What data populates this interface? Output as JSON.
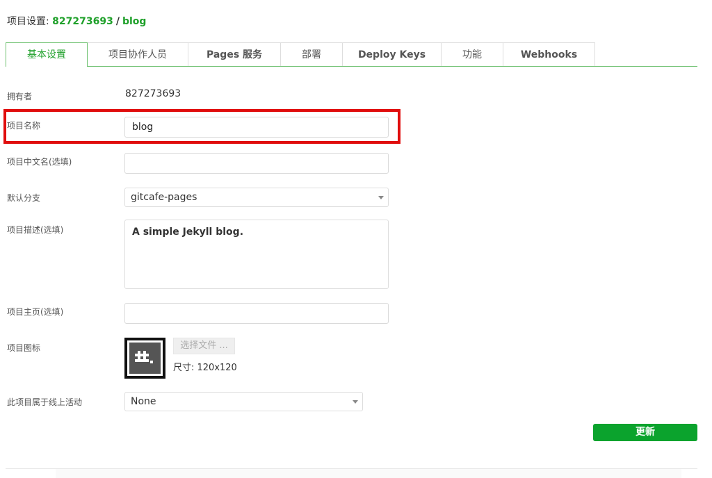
{
  "header": {
    "prefix": "项目设置:",
    "owner": "827273693",
    "separator": "/",
    "project": "blog"
  },
  "tabs": [
    {
      "label": "基本设置",
      "active": true
    },
    {
      "label": "项目协作人员",
      "active": false
    },
    {
      "label": "Pages 服务",
      "active": false
    },
    {
      "label": "部署",
      "active": false
    },
    {
      "label": "Deploy Keys",
      "active": false
    },
    {
      "label": "功能",
      "active": false
    },
    {
      "label": "Webhooks",
      "active": false
    }
  ],
  "form": {
    "owner": {
      "label": "拥有者",
      "value": "827273693"
    },
    "name": {
      "label": "项目名称",
      "value": "blog"
    },
    "cn_name": {
      "label": "项目中文名(选填)",
      "value": ""
    },
    "branch": {
      "label": "默认分支",
      "value": "gitcafe-pages"
    },
    "description": {
      "label": "项目描述(选填)",
      "value": "A simple Jekyll blog."
    },
    "homepage": {
      "label": "项目主页(选填)",
      "value": ""
    },
    "icon": {
      "label": "项目图标",
      "button": "选择文件 ...",
      "size_text": "尺寸: 120x120"
    },
    "activity": {
      "label": "此项目属于线上活动",
      "value": "None"
    }
  },
  "buttons": {
    "update": "更新"
  },
  "colors": {
    "accent": "#1fa02a",
    "update_button": "#0ba32d",
    "highlight": "#e00d0d"
  }
}
